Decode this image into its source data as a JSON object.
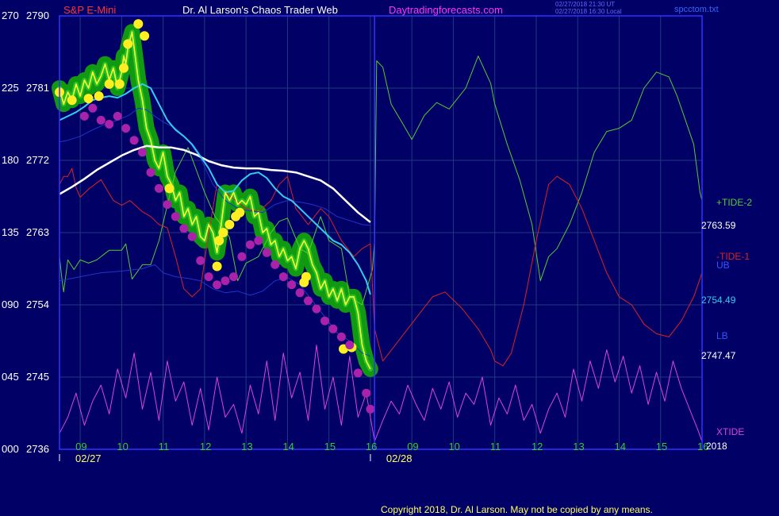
{
  "header": {
    "instrument": "S&P E-Mini",
    "site_title": "Dr. Al Larson's Chaos Trader Web",
    "site_url": "Daytradingforecasts.com",
    "timestamp_1": "02/27/2018 21:30 UT",
    "timestamp_2": "02/27/2018 16:30 Local",
    "data_file": "spcctom.txt"
  },
  "footer": {
    "copyright": "Copyright 2018, Dr. Al Larson. May not be copied by any means."
  },
  "colors": {
    "background": "#000066",
    "plot_frame": "#3333ff",
    "grid": "#1e3a80",
    "axis_text": "#ffffff",
    "instrument_title": "#ff3333",
    "site_url": "#ff33ff",
    "hour_labels": "#33cc33",
    "date_labels": "#ffff66",
    "tide2": "#55cc33",
    "tide1": "#dd2222",
    "xtide": "#dd44dd",
    "ub": "#2233cc",
    "lb": "#2233cc",
    "average_white": "#ffffff",
    "average_cyan": "#33ccee",
    "price_line": "#ffff33",
    "price_band": "#119911",
    "high_dots": "#ffee22",
    "low_dots": "#aa22aa"
  },
  "chart_data": {
    "type": "line",
    "y_axis_left": {
      "ticks": [
        {
          "osc": "270",
          "price": "2790"
        },
        {
          "osc": "225",
          "price": "2781"
        },
        {
          "osc": "180",
          "price": "2772"
        },
        {
          "osc": "135",
          "price": "2763"
        },
        {
          "osc": "090",
          "price": "2754"
        },
        {
          "osc": "045",
          "price": "2745"
        },
        {
          "osc": "000",
          "price": "2736"
        }
      ],
      "price_range": [
        2736,
        2790
      ],
      "osc_range": [
        0,
        270
      ]
    },
    "x_axis": {
      "range": [
        8.5,
        24
      ],
      "hour_ticks": [
        {
          "x": 9,
          "label": "09"
        },
        {
          "x": 10,
          "label": "10"
        },
        {
          "x": 11,
          "label": "11"
        },
        {
          "x": 12,
          "label": "12"
        },
        {
          "x": 13,
          "label": "13"
        },
        {
          "x": 14,
          "label": "14"
        },
        {
          "x": 15,
          "label": "15"
        },
        {
          "x": 16,
          "label": "16"
        },
        {
          "x": 17,
          "label": "09"
        },
        {
          "x": 18,
          "label": "10"
        },
        {
          "x": 19,
          "label": "11"
        },
        {
          "x": 20,
          "label": "12"
        },
        {
          "x": 21,
          "label": "13"
        },
        {
          "x": 22,
          "label": "14"
        },
        {
          "x": 23,
          "label": "15"
        },
        {
          "x": 24,
          "label": "16"
        }
      ],
      "date_labels": [
        {
          "x": 8.5,
          "label": "02/27"
        },
        {
          "x": 16,
          "label": "02/28"
        }
      ],
      "year_label": "2018",
      "divider_x": 16.1
    },
    "right_labels": {
      "tide2": "+TIDE-2",
      "tide1": "-TIDE-1",
      "ub": "UB",
      "lb": "LB",
      "xtide": "XTIDE",
      "price_ub": "2763.59",
      "price_mid": "2754.49",
      "price_lb": "2747.47"
    },
    "series": [
      {
        "name": "+TIDE-2",
        "axis": "osc",
        "x": [
          8.5,
          8.55,
          8.6,
          8.7,
          8.85,
          9.0,
          9.2,
          9.4,
          9.7,
          10.0,
          10.1,
          10.25,
          10.5,
          10.55,
          10.7,
          10.9,
          11.1,
          11.3,
          11.6,
          12.0,
          12.25,
          12.4,
          12.6,
          12.8,
          13.0,
          13.3,
          13.6,
          13.8,
          14.0,
          14.3,
          14.5,
          14.8,
          15.0,
          15.3,
          15.5,
          15.8,
          16.05,
          16.1,
          16.15,
          16.3,
          16.5,
          16.8,
          17.0,
          17.3,
          17.6,
          17.9,
          18.3,
          18.6,
          18.9,
          19.0,
          19.3,
          19.6,
          19.9,
          20.1,
          20.3,
          20.5,
          20.8,
          21.1,
          21.4,
          21.7,
          22.0,
          22.3,
          22.6,
          22.9,
          23.2,
          23.4,
          23.6,
          23.8,
          23.95,
          24.0
        ],
        "y": [
          120,
          108,
          98,
          118,
          112,
          118,
          116,
          118,
          124,
          124,
          128,
          106,
          115,
          115,
          115,
          130,
          152,
          173,
          188,
          160,
          145,
          140,
          132,
          105,
          116,
          120,
          135,
          142,
          144,
          125,
          122,
          145,
          130,
          125,
          95,
          90,
          112,
          130,
          242,
          238,
          215,
          202,
          193,
          208,
          216,
          212,
          225,
          245,
          228,
          215,
          190,
          168,
          140,
          105,
          120,
          125,
          140,
          160,
          185,
          198,
          200,
          205,
          225,
          235,
          232,
          220,
          205,
          190,
          160,
          155
        ]
      },
      {
        "name": "-TIDE-1",
        "axis": "osc",
        "x": [
          8.5,
          8.6,
          8.7,
          8.8,
          8.9,
          9.0,
          9.2,
          9.5,
          9.8,
          10.0,
          10.2,
          10.5,
          10.7,
          10.9,
          11.1,
          11.3,
          11.5,
          11.7,
          11.9,
          12.1,
          12.3,
          12.6,
          13.0,
          13.3,
          13.6,
          13.8,
          14.0,
          14.2,
          14.5,
          14.8,
          15.0,
          15.3,
          15.6,
          15.8,
          16.0,
          16.1,
          16.3,
          16.6,
          16.9,
          17.2,
          17.5,
          17.8,
          18.2,
          18.6,
          18.9,
          19.0,
          19.2,
          19.4,
          19.7,
          20.0,
          20.3,
          20.5,
          20.8,
          21.1,
          21.4,
          21.7,
          22.0,
          22.3,
          22.6,
          22.9,
          23.2,
          23.5,
          23.8,
          24.0
        ],
        "y": [
          165,
          170,
          170,
          175,
          163,
          157,
          162,
          168,
          155,
          152,
          155,
          148,
          145,
          140,
          138,
          120,
          100,
          95,
          100,
          135,
          165,
          158,
          150,
          148,
          155,
          165,
          170,
          150,
          140,
          150,
          145,
          130,
          120,
          125,
          128,
          75,
          55,
          65,
          75,
          85,
          95,
          98,
          88,
          75,
          62,
          55,
          52,
          60,
          90,
          130,
          165,
          170,
          165,
          150,
          130,
          110,
          95,
          90,
          78,
          72,
          70,
          80,
          95,
          110
        ]
      },
      {
        "name": "XTIDE",
        "axis": "osc",
        "x": [
          8.5,
          8.7,
          8.9,
          9.1,
          9.3,
          9.5,
          9.7,
          9.9,
          10.1,
          10.3,
          10.5,
          10.7,
          10.9,
          11.1,
          11.3,
          11.5,
          11.7,
          11.9,
          12.1,
          12.3,
          12.5,
          12.7,
          12.9,
          13.1,
          13.3,
          13.5,
          13.7,
          13.9,
          14.1,
          14.3,
          14.5,
          14.7,
          14.9,
          15.1,
          15.3,
          15.5,
          15.7,
          15.9,
          16.1,
          16.3,
          16.5,
          16.7,
          16.9,
          17.1,
          17.3,
          17.5,
          17.7,
          17.9,
          18.1,
          18.3,
          18.5,
          18.7,
          18.9,
          19.1,
          19.3,
          19.5,
          19.7,
          19.9,
          20.1,
          20.3,
          20.5,
          20.7,
          20.9,
          21.1,
          21.3,
          21.5,
          21.7,
          21.9,
          22.1,
          22.3,
          22.5,
          22.7,
          22.9,
          23.1,
          23.3,
          23.5,
          23.7,
          23.9,
          24.0
        ],
        "y": [
          10,
          20,
          35,
          15,
          30,
          40,
          22,
          50,
          32,
          60,
          25,
          48,
          18,
          55,
          30,
          42,
          15,
          38,
          12,
          45,
          20,
          28,
          10,
          40,
          22,
          55,
          18,
          60,
          32,
          48,
          18,
          65,
          25,
          45,
          15,
          58,
          20,
          35,
          5,
          18,
          30,
          22,
          40,
          28,
          18,
          38,
          25,
          42,
          20,
          35,
          28,
          45,
          15,
          32,
          22,
          40,
          18,
          28,
          10,
          25,
          35,
          20,
          50,
          30,
          55,
          38,
          62,
          42,
          58,
          35,
          52,
          28,
          48,
          30,
          55,
          38,
          25,
          12,
          5
        ]
      },
      {
        "name": "UB",
        "axis": "price",
        "x": [
          8.5,
          8.7,
          9.0,
          9.3,
          9.6,
          9.9,
          10.2,
          10.4,
          10.6,
          10.8,
          11.0,
          11.3,
          11.6,
          11.9,
          12.2,
          12.5,
          12.8,
          13.1,
          13.4,
          13.7,
          14.0,
          14.3,
          14.6,
          14.9,
          15.2,
          15.5,
          15.8,
          16.0
        ],
        "y": [
          2774.3,
          2774.5,
          2775.0,
          2775.8,
          2776.5,
          2777.0,
          2777.7,
          2778.5,
          2778.3,
          2777.5,
          2776.8,
          2776.0,
          2774.5,
          2772.3,
          2769.0,
          2767.0,
          2766.0,
          2765.7,
          2765.5,
          2766.5,
          2767.0,
          2766.8,
          2766.5,
          2766.0,
          2765.0,
          2764.5,
          2764.0,
          2763.9
        ]
      },
      {
        "name": "LB",
        "axis": "price",
        "x": [
          8.5,
          9.0,
          9.5,
          10.0,
          10.5,
          10.8,
          11.0,
          11.3,
          11.6,
          11.9,
          12.2,
          12.5,
          12.8,
          13.1,
          13.4,
          13.7,
          14.0,
          14.3,
          14.6,
          14.9,
          15.2,
          15.5,
          15.8,
          16.0
        ],
        "y": [
          2757,
          2757.5,
          2758,
          2758.2,
          2758.5,
          2759,
          2758,
          2757.5,
          2757.3,
          2757,
          2756,
          2755.5,
          2755.7,
          2755.2,
          2755.7,
          2757,
          2757.4,
          2756.5,
          2754.5,
          2752.5,
          2750.5,
          2749.5,
          2748,
          2747.6
        ]
      },
      {
        "name": "Average (white)",
        "axis": "price",
        "x": [
          8.5,
          8.8,
          9.1,
          9.4,
          9.7,
          10.0,
          10.3,
          10.6,
          10.9,
          11.2,
          11.5,
          11.8,
          12.1,
          12.4,
          12.7,
          13.0,
          13.3,
          13.6,
          13.9,
          14.2,
          14.5,
          14.8,
          15.1,
          15.4,
          15.7,
          16.0
        ],
        "y": [
          2767.8,
          2768.7,
          2769.7,
          2770.8,
          2771.7,
          2772.6,
          2773.3,
          2773.8,
          2773.6,
          2773.6,
          2773.3,
          2772.7,
          2771.9,
          2771.4,
          2771.1,
          2771.0,
          2771.0,
          2770.8,
          2770.7,
          2770.5,
          2770.0,
          2769.5,
          2768.5,
          2767.0,
          2765.5,
          2764.3
        ]
      },
      {
        "name": "Average (cyan)",
        "axis": "price",
        "x": [
          8.5,
          8.7,
          8.9,
          9.1,
          9.3,
          9.5,
          9.7,
          9.9,
          10.1,
          10.3,
          10.5,
          10.7,
          10.9,
          11.1,
          11.3,
          11.5,
          11.7,
          11.9,
          12.1,
          12.3,
          12.5,
          12.7,
          12.9,
          13.1,
          13.3,
          13.5,
          13.7,
          13.9,
          14.1,
          14.3,
          14.5,
          14.7,
          14.9,
          15.1,
          15.3,
          15.5,
          15.7,
          15.9,
          16.0
        ],
        "y": [
          2777,
          2777.5,
          2778,
          2778.7,
          2779.5,
          2779.8,
          2780,
          2779.8,
          2780.3,
          2781,
          2781.5,
          2781,
          2779,
          2777,
          2775.8,
          2775,
          2774,
          2772.5,
          2771,
          2769,
          2768,
          2768.2,
          2769.5,
          2770.3,
          2770.5,
          2769.8,
          2768.5,
          2767.5,
          2767,
          2766,
          2765,
          2764,
          2763,
          2762,
          2761.5,
          2760.5,
          2759,
          2757,
          2755.3
        ]
      },
      {
        "name": "Price (yellow)",
        "axis": "price",
        "x": [
          8.5,
          8.6,
          8.7,
          8.8,
          8.9,
          9.0,
          9.1,
          9.2,
          9.3,
          9.4,
          9.5,
          9.6,
          9.7,
          9.8,
          9.9,
          10.0,
          10.05,
          10.1,
          10.15,
          10.2,
          10.25,
          10.3,
          10.35,
          10.4,
          10.5,
          10.6,
          10.7,
          10.8,
          10.9,
          11.0,
          11.1,
          11.2,
          11.3,
          11.4,
          11.5,
          11.6,
          11.7,
          11.8,
          11.9,
          12.0,
          12.1,
          12.2,
          12.3,
          12.4,
          12.5,
          12.6,
          12.7,
          12.8,
          12.9,
          13.0,
          13.1,
          13.2,
          13.3,
          13.4,
          13.5,
          13.6,
          13.7,
          13.8,
          13.9,
          14.0,
          14.1,
          14.2,
          14.3,
          14.4,
          14.5,
          14.6,
          14.7,
          14.8,
          14.9,
          15.0,
          15.1,
          15.2,
          15.3,
          15.4,
          15.5,
          15.6,
          15.7,
          15.8,
          15.9,
          16.0
        ],
        "y": [
          2781,
          2779,
          2780.5,
          2779.5,
          2781.5,
          2780,
          2782,
          2781,
          2783,
          2781.5,
          2782.5,
          2784,
          2782,
          2783.5,
          2781,
          2783,
          2785,
          2784,
          2786,
          2787,
          2788,
          2786,
          2784,
          2782,
          2779.5,
          2776,
          2774.5,
          2772,
          2771,
          2773,
          2770,
          2769,
          2767,
          2768,
          2765,
          2766,
          2764,
          2765,
          2762.5,
          2762,
          2764,
          2763,
          2760.5,
          2764,
          2768,
          2767,
          2768,
          2766.5,
          2767,
          2766.5,
          2767.5,
          2765,
          2765.5,
          2763,
          2763.5,
          2761.5,
          2762,
          2760,
          2761,
          2759.5,
          2760,
          2758.5,
          2761,
          2762,
          2761,
          2759,
          2758,
          2756,
          2757,
          2755,
          2756,
          2754.5,
          2756,
          2754,
          2755,
          2755,
          2753,
          2749,
          2747,
          2746
        ]
      }
    ],
    "scatter_series": [
      {
        "name": "Highs (yellow dots)",
        "axis": "price",
        "x": [
          8.5,
          8.8,
          9.2,
          9.45,
          9.7,
          9.95,
          10.05,
          10.15,
          10.4,
          10.55,
          11.15,
          12.3,
          12.35,
          12.45,
          12.6,
          12.75,
          12.85,
          14.4,
          14.45,
          15.35,
          15.55
        ],
        "y": [
          2780.5,
          2779.5,
          2779.7,
          2780,
          2781.5,
          2781.5,
          2783.5,
          2786.5,
          2789,
          2787.5,
          2768.5,
          2758.8,
          2762,
          2763,
          2764,
          2765,
          2765.5,
          2756.8,
          2757.5,
          2748.5,
          2748.7
        ]
      },
      {
        "name": "Lows (magenta dots)",
        "axis": "price",
        "x": [
          9.1,
          9.3,
          9.5,
          9.7,
          9.9,
          10.1,
          10.3,
          10.5,
          10.7,
          10.9,
          11.1,
          11.3,
          11.5,
          11.7,
          11.9,
          12.1,
          12.3,
          12.5,
          12.7,
          12.9,
          13.1,
          13.3,
          13.5,
          13.7,
          13.9,
          14.1,
          14.3,
          14.5,
          14.7,
          14.9,
          15.1,
          15.3,
          15.5,
          15.7,
          15.9,
          16.0
        ],
        "y": [
          2777.5,
          2778.5,
          2777,
          2776.5,
          2777.5,
          2776,
          2774.5,
          2773,
          2770.5,
          2768.5,
          2766.5,
          2765,
          2763.5,
          2762.5,
          2759.5,
          2757.5,
          2756.5,
          2757,
          2757.5,
          2760,
          2761.5,
          2762,
          2760.5,
          2759,
          2757.5,
          2756.5,
          2755.5,
          2754.5,
          2753.5,
          2752,
          2751,
          2750,
          2749,
          2745.5,
          2743,
          2741
        ]
      }
    ]
  }
}
